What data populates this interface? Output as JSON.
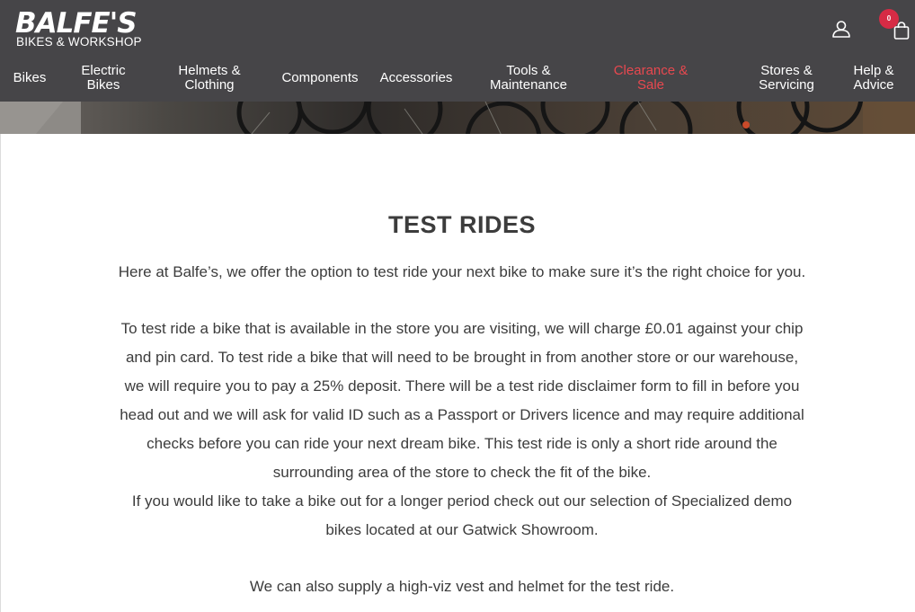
{
  "header": {
    "logo_main": "BALFE'S",
    "logo_sub": "BIKES & WORKSHOP",
    "cart_count": "0"
  },
  "nav": {
    "items": [
      {
        "label": "Bikes"
      },
      {
        "label": "Electric\nBikes"
      },
      {
        "label": "Helmets &\nClothing"
      },
      {
        "label": "Components"
      },
      {
        "label": "Accessories"
      },
      {
        "label": "Tools &\nMaintenance"
      },
      {
        "label": "Clearance &\nSale"
      },
      {
        "label": "Stores &\nServicing"
      },
      {
        "label": "Help &\nAdvice"
      }
    ]
  },
  "page": {
    "title": "TEST RIDES",
    "intro": "Here at Balfe’s, we offer the option to test ride your next bike to make sure it’s the right choice for you.",
    "body_lines": [
      "To test ride a bike that is available in the store you are visiting, we will charge £0.01 against your chip",
      "and pin card. To test ride a bike that will need to be brought in from another store or our warehouse,",
      "we will require you to pay a 25% deposit. There will be a test ride disclaimer form to fill in before you",
      "head out and we will ask for valid ID such as a Passport or Drivers licence and may require additional",
      "checks before you can ride your next dream bike. This test ride is only a short ride around the",
      "surrounding area of the store to check the fit of the bike.",
      "If you would like to take a bike out for a longer period check out our selection of Specialized demo",
      "bikes located at our Gatwick Showroom."
    ],
    "closing": "We can also supply a high-viz vest and helmet for the test ride."
  }
}
